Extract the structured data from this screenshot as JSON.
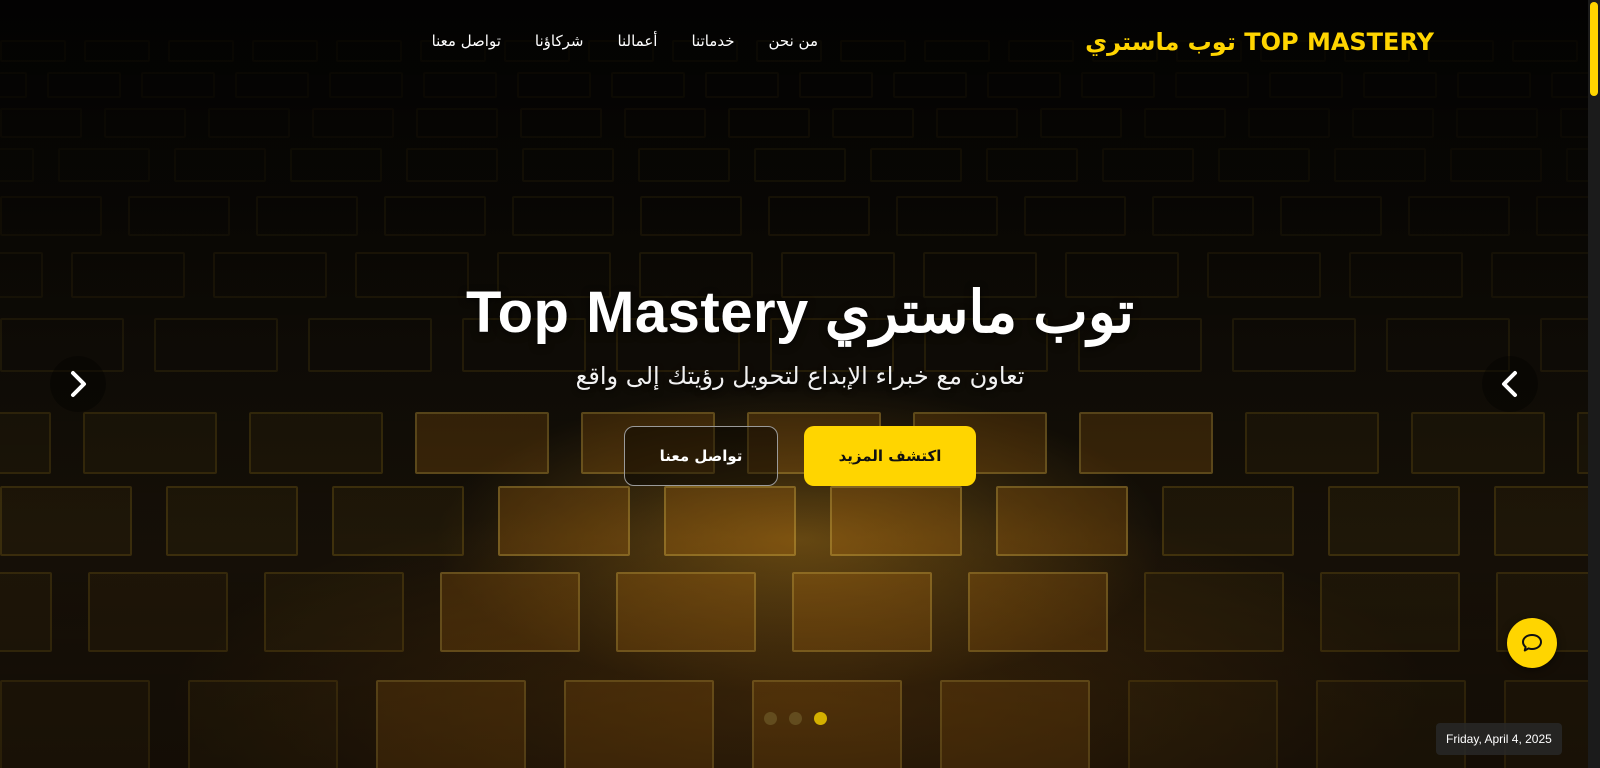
{
  "navbar": {
    "brand": "TOP MASTERY توب ماستري",
    "links": [
      {
        "label": "من نحن"
      },
      {
        "label": "خدماتنا"
      },
      {
        "label": "أعمالنا"
      },
      {
        "label": "شركاؤنا"
      },
      {
        "label": "تواصل معنا"
      }
    ]
  },
  "hero": {
    "title": "توب ماستري Top Mastery",
    "subtitle": "تعاون مع خبراء الإبداع لتحويل رؤيتك إلى واقع",
    "primary_button": "اكتشف المزيد",
    "secondary_button": "تواصل معنا"
  },
  "carousel": {
    "prev_icon": "chevron-right-icon",
    "next_icon": "chevron-left-icon",
    "slide_count": 3,
    "active_slide": 3
  },
  "chat": {
    "icon": "chat-bubble-icon"
  },
  "date_badge": "Friday, April 4, 2025",
  "colors": {
    "accent": "#ffd500",
    "background": "#0b0905"
  }
}
